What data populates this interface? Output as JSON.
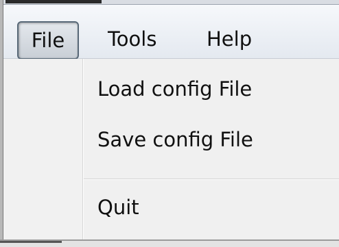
{
  "menubar": {
    "items": [
      {
        "label": "File"
      },
      {
        "label": "Tools"
      },
      {
        "label": "Help"
      }
    ]
  },
  "file_menu": {
    "items": [
      {
        "label": "Load config File"
      },
      {
        "label": "Save config File"
      },
      {
        "label": "Quit"
      }
    ]
  }
}
